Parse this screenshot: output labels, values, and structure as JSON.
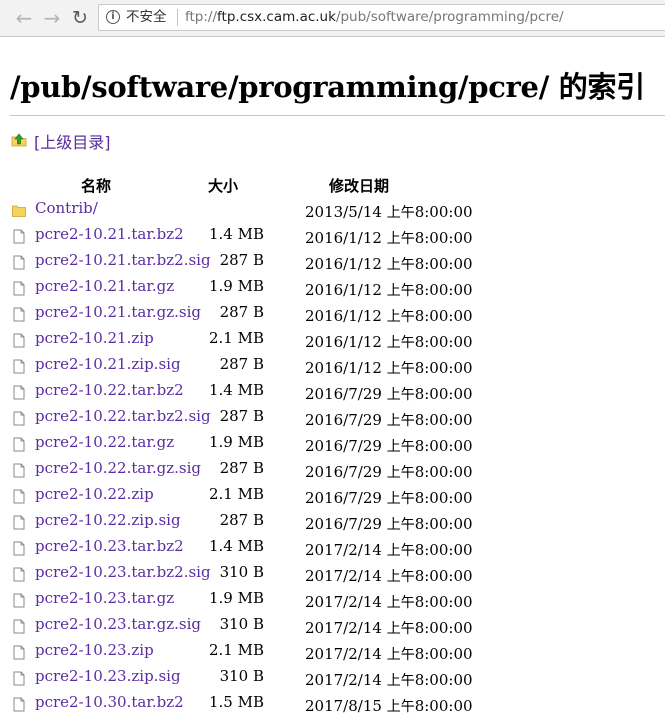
{
  "browser": {
    "security_label": "不安全",
    "url_scheme": "ftp://",
    "url_host": "ftp.csx.cam.ac.uk",
    "url_path": "/pub/software/programming/pcre/",
    "icons": {
      "back": "back-arrow-icon",
      "forward": "forward-arrow-icon",
      "reload": "reload-icon",
      "info": "info-icon"
    }
  },
  "page": {
    "title_path": "/pub/software/programming/pcre/",
    "title_suffix": "的索引",
    "parent_link": "[上级目录]",
    "columns": {
      "name": "名称",
      "size": "大小",
      "modified": "修改日期"
    },
    "colors": {
      "link": "#5a2ca0",
      "folder": "#f4d35e",
      "up_arrow": "#3a9a2a"
    }
  },
  "entries": [
    {
      "name": "Contrib/",
      "size": "",
      "date": "2013/5/14",
      "ampm": "上午",
      "time": "8:00:00",
      "type": "folder"
    },
    {
      "name": "pcre2-10.21.tar.bz2",
      "size": "1.4 MB",
      "date": "2016/1/12",
      "ampm": "上午",
      "time": "8:00:00",
      "type": "file"
    },
    {
      "name": "pcre2-10.21.tar.bz2.sig",
      "size": "287 B",
      "date": "2016/1/12",
      "ampm": "上午",
      "time": "8:00:00",
      "type": "file"
    },
    {
      "name": "pcre2-10.21.tar.gz",
      "size": "1.9 MB",
      "date": "2016/1/12",
      "ampm": "上午",
      "time": "8:00:00",
      "type": "file"
    },
    {
      "name": "pcre2-10.21.tar.gz.sig",
      "size": "287 B",
      "date": "2016/1/12",
      "ampm": "上午",
      "time": "8:00:00",
      "type": "file"
    },
    {
      "name": "pcre2-10.21.zip",
      "size": "2.1 MB",
      "date": "2016/1/12",
      "ampm": "上午",
      "time": "8:00:00",
      "type": "file"
    },
    {
      "name": "pcre2-10.21.zip.sig",
      "size": "287 B",
      "date": "2016/1/12",
      "ampm": "上午",
      "time": "8:00:00",
      "type": "file"
    },
    {
      "name": "pcre2-10.22.tar.bz2",
      "size": "1.4 MB",
      "date": "2016/7/29",
      "ampm": "上午",
      "time": "8:00:00",
      "type": "file"
    },
    {
      "name": "pcre2-10.22.tar.bz2.sig",
      "size": "287 B",
      "date": "2016/7/29",
      "ampm": "上午",
      "time": "8:00:00",
      "type": "file"
    },
    {
      "name": "pcre2-10.22.tar.gz",
      "size": "1.9 MB",
      "date": "2016/7/29",
      "ampm": "上午",
      "time": "8:00:00",
      "type": "file"
    },
    {
      "name": "pcre2-10.22.tar.gz.sig",
      "size": "287 B",
      "date": "2016/7/29",
      "ampm": "上午",
      "time": "8:00:00",
      "type": "file"
    },
    {
      "name": "pcre2-10.22.zip",
      "size": "2.1 MB",
      "date": "2016/7/29",
      "ampm": "上午",
      "time": "8:00:00",
      "type": "file"
    },
    {
      "name": "pcre2-10.22.zip.sig",
      "size": "287 B",
      "date": "2016/7/29",
      "ampm": "上午",
      "time": "8:00:00",
      "type": "file"
    },
    {
      "name": "pcre2-10.23.tar.bz2",
      "size": "1.4 MB",
      "date": "2017/2/14",
      "ampm": "上午",
      "time": "8:00:00",
      "type": "file"
    },
    {
      "name": "pcre2-10.23.tar.bz2.sig",
      "size": "310 B",
      "date": "2017/2/14",
      "ampm": "上午",
      "time": "8:00:00",
      "type": "file"
    },
    {
      "name": "pcre2-10.23.tar.gz",
      "size": "1.9 MB",
      "date": "2017/2/14",
      "ampm": "上午",
      "time": "8:00:00",
      "type": "file"
    },
    {
      "name": "pcre2-10.23.tar.gz.sig",
      "size": "310 B",
      "date": "2017/2/14",
      "ampm": "上午",
      "time": "8:00:00",
      "type": "file"
    },
    {
      "name": "pcre2-10.23.zip",
      "size": "2.1 MB",
      "date": "2017/2/14",
      "ampm": "上午",
      "time": "8:00:00",
      "type": "file"
    },
    {
      "name": "pcre2-10.23.zip.sig",
      "size": "310 B",
      "date": "2017/2/14",
      "ampm": "上午",
      "time": "8:00:00",
      "type": "file"
    },
    {
      "name": "pcre2-10.30.tar.bz2",
      "size": "1.5 MB",
      "date": "2017/8/15",
      "ampm": "上午",
      "time": "8:00:00",
      "type": "file"
    }
  ]
}
